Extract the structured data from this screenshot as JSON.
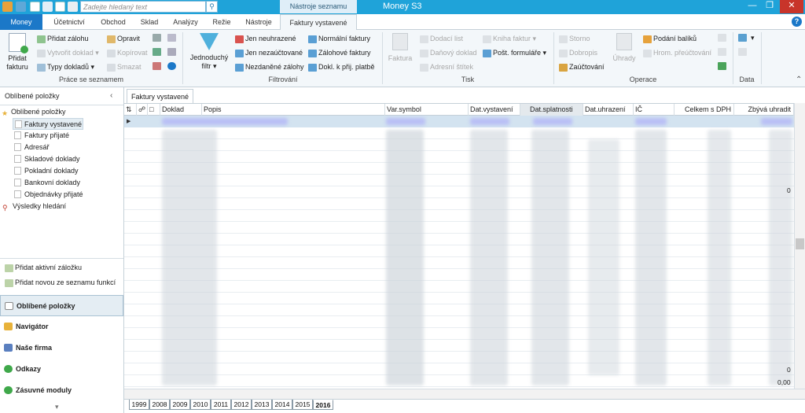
{
  "titlebar": {
    "search_placeholder": "Zadejte hledaný text",
    "context_tab": "Nástroje seznamu",
    "app_title": "Money S3"
  },
  "tabs": [
    "Money",
    "Účetnictví",
    "Obchod",
    "Sklad",
    "Analýzy",
    "Režie",
    "Nástroje",
    "Faktury vystavené"
  ],
  "ribbon": {
    "new_invoice": "Přidat fakturu",
    "add_advance": "Přidat zálohu",
    "create_doc": "Vytvořit doklad",
    "doc_types": "Typy dokladů",
    "edit": "Opravit",
    "copy": "Kopírovat",
    "delete": "Smazat",
    "group_list": "Práce se seznamem",
    "simple_filter": "Jednoduchý filtr",
    "only_unpaid": "Jen neuhrazené",
    "only_unposted": "Jen nezaúčtované",
    "untaxed_adv": "Nezdaněné zálohy",
    "normal_inv": "Normální faktury",
    "advance_inv": "Zálohové faktury",
    "doc_to_payment": "Dokl. k přij. platbě",
    "group_filter": "Filtrování",
    "print_invoice": "Faktura",
    "delivery_note": "Dodací list",
    "tax_doc": "Daňový doklad",
    "address_label": "Adresní štítek",
    "inv_book": "Kniha faktur",
    "post_forms": "Pošt. formuláře",
    "group_print": "Tisk",
    "cancel": "Storno",
    "credit_note": "Dobropis",
    "post": "Zaúčtování",
    "payments": "Úhrady",
    "send_parcels": "Podání balíků",
    "bulk_transfer": "Hrom. přeúčtování",
    "group_ops": "Operace",
    "group_data": "Data"
  },
  "sidebar": {
    "header": "Oblíbené položky",
    "tree": [
      "Oblíbené položky",
      "Faktury vystavené",
      "Faktury přijaté",
      "Adresář",
      "Skladové doklady",
      "Pokladní doklady",
      "Bankovní doklady",
      "Objednávky přijaté",
      "Výsledky hledání"
    ],
    "add_active": "Přidat aktivní záložku",
    "add_new": "Přidat novou ze seznamu funkcí",
    "nav": [
      "Oblíbené položky",
      "Navigátor",
      "Naše firma",
      "Odkazy",
      "Zásuvné moduly"
    ]
  },
  "main": {
    "doc_tab": "Faktury vystavené",
    "columns": [
      "Doklad",
      "Popis",
      "Var.symbol",
      "Dat.vystavení",
      "Dat.splatnosti",
      "Dat.uhrazení",
      "IČ",
      "Celkem s DPH",
      "Zbývá uhradit"
    ],
    "right_frag_1": "0",
    "right_frag_2": "0",
    "right_frag_3": "0,00",
    "years": [
      "1999",
      "2008",
      "2009",
      "2010",
      "2011",
      "2012",
      "2013",
      "2014",
      "2015",
      "2016"
    ]
  },
  "colors": {
    "accent": "#1fa3d9",
    "money_tab": "#1b78c8",
    "ribbon_bg": "#f3f7fa"
  }
}
